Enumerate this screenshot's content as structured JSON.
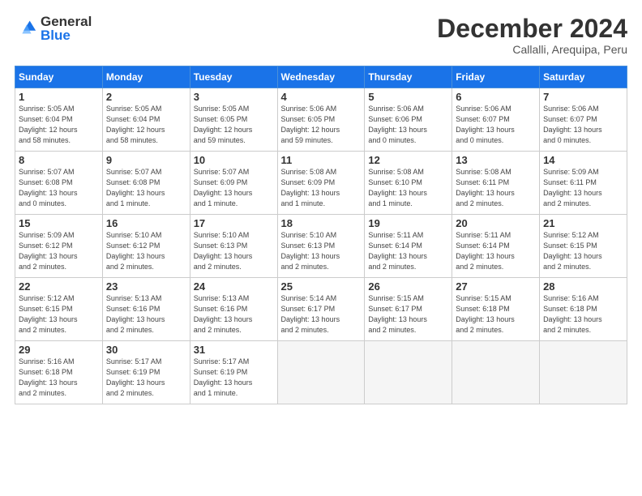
{
  "header": {
    "logo_general": "General",
    "logo_blue": "Blue",
    "title": "December 2024",
    "subtitle": "Callalli, Arequipa, Peru"
  },
  "calendar": {
    "days_of_week": [
      "Sunday",
      "Monday",
      "Tuesday",
      "Wednesday",
      "Thursday",
      "Friday",
      "Saturday"
    ],
    "weeks": [
      [
        null,
        null,
        null,
        {
          "day": 4,
          "sunrise": "5:06 AM",
          "sunset": "6:05 PM",
          "daylight": "12 hours and 59 minutes."
        },
        {
          "day": 5,
          "sunrise": "5:06 AM",
          "sunset": "6:06 PM",
          "daylight": "13 hours and 0 minutes."
        },
        {
          "day": 6,
          "sunrise": "5:06 AM",
          "sunset": "6:07 PM",
          "daylight": "13 hours and 0 minutes."
        },
        {
          "day": 7,
          "sunrise": "5:06 AM",
          "sunset": "6:07 PM",
          "daylight": "13 hours and 0 minutes."
        }
      ],
      [
        {
          "day": 1,
          "sunrise": "5:05 AM",
          "sunset": "6:04 PM",
          "daylight": "12 hours and 58 minutes."
        },
        {
          "day": 2,
          "sunrise": "5:05 AM",
          "sunset": "6:04 PM",
          "daylight": "12 hours and 58 minutes."
        },
        {
          "day": 3,
          "sunrise": "5:05 AM",
          "sunset": "6:05 PM",
          "daylight": "12 hours and 59 minutes."
        },
        null,
        null,
        null,
        null
      ],
      [
        {
          "day": 8,
          "sunrise": "5:07 AM",
          "sunset": "6:08 PM",
          "daylight": "13 hours and 0 minutes."
        },
        {
          "day": 9,
          "sunrise": "5:07 AM",
          "sunset": "6:08 PM",
          "daylight": "13 hours and 1 minute."
        },
        {
          "day": 10,
          "sunrise": "5:07 AM",
          "sunset": "6:09 PM",
          "daylight": "13 hours and 1 minute."
        },
        {
          "day": 11,
          "sunrise": "5:08 AM",
          "sunset": "6:09 PM",
          "daylight": "13 hours and 1 minute."
        },
        {
          "day": 12,
          "sunrise": "5:08 AM",
          "sunset": "6:10 PM",
          "daylight": "13 hours and 1 minute."
        },
        {
          "day": 13,
          "sunrise": "5:08 AM",
          "sunset": "6:11 PM",
          "daylight": "13 hours and 2 minutes."
        },
        {
          "day": 14,
          "sunrise": "5:09 AM",
          "sunset": "6:11 PM",
          "daylight": "13 hours and 2 minutes."
        }
      ],
      [
        {
          "day": 15,
          "sunrise": "5:09 AM",
          "sunset": "6:12 PM",
          "daylight": "13 hours and 2 minutes."
        },
        {
          "day": 16,
          "sunrise": "5:10 AM",
          "sunset": "6:12 PM",
          "daylight": "13 hours and 2 minutes."
        },
        {
          "day": 17,
          "sunrise": "5:10 AM",
          "sunset": "6:13 PM",
          "daylight": "13 hours and 2 minutes."
        },
        {
          "day": 18,
          "sunrise": "5:10 AM",
          "sunset": "6:13 PM",
          "daylight": "13 hours and 2 minutes."
        },
        {
          "day": 19,
          "sunrise": "5:11 AM",
          "sunset": "6:14 PM",
          "daylight": "13 hours and 2 minutes."
        },
        {
          "day": 20,
          "sunrise": "5:11 AM",
          "sunset": "6:14 PM",
          "daylight": "13 hours and 2 minutes."
        },
        {
          "day": 21,
          "sunrise": "5:12 AM",
          "sunset": "6:15 PM",
          "daylight": "13 hours and 2 minutes."
        }
      ],
      [
        {
          "day": 22,
          "sunrise": "5:12 AM",
          "sunset": "6:15 PM",
          "daylight": "13 hours and 2 minutes."
        },
        {
          "day": 23,
          "sunrise": "5:13 AM",
          "sunset": "6:16 PM",
          "daylight": "13 hours and 2 minutes."
        },
        {
          "day": 24,
          "sunrise": "5:13 AM",
          "sunset": "6:16 PM",
          "daylight": "13 hours and 2 minutes."
        },
        {
          "day": 25,
          "sunrise": "5:14 AM",
          "sunset": "6:17 PM",
          "daylight": "13 hours and 2 minutes."
        },
        {
          "day": 26,
          "sunrise": "5:15 AM",
          "sunset": "6:17 PM",
          "daylight": "13 hours and 2 minutes."
        },
        {
          "day": 27,
          "sunrise": "5:15 AM",
          "sunset": "6:18 PM",
          "daylight": "13 hours and 2 minutes."
        },
        {
          "day": 28,
          "sunrise": "5:16 AM",
          "sunset": "6:18 PM",
          "daylight": "13 hours and 2 minutes."
        }
      ],
      [
        {
          "day": 29,
          "sunrise": "5:16 AM",
          "sunset": "6:18 PM",
          "daylight": "13 hours and 2 minutes."
        },
        {
          "day": 30,
          "sunrise": "5:17 AM",
          "sunset": "6:19 PM",
          "daylight": "13 hours and 2 minutes."
        },
        {
          "day": 31,
          "sunrise": "5:17 AM",
          "sunset": "6:19 PM",
          "daylight": "13 hours and 1 minute."
        },
        null,
        null,
        null,
        null
      ]
    ]
  }
}
